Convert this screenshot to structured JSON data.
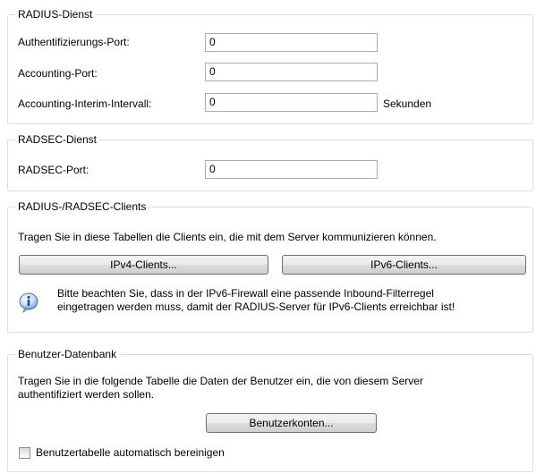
{
  "radius_service": {
    "legend": "RADIUS-Dienst",
    "auth_port_label": "Authentifizierungs-Port:",
    "auth_port_value": "0",
    "acct_port_label": "Accounting-Port:",
    "acct_port_value": "0",
    "interim_label": "Accounting-Interim-Intervall:",
    "interim_value": "0",
    "interim_unit": "Sekunden"
  },
  "radsec_service": {
    "legend": "RADSEC-Dienst",
    "port_label": "RADSEC-Port:",
    "port_value": "0"
  },
  "clients": {
    "legend": "RADIUS-/RADSEC-Clients",
    "description": "Tragen Sie in diese Tabellen die Clients ein, die mit dem Server kommunizieren können.",
    "ipv4_button": "IPv4-Clients...",
    "ipv6_button": "IPv6-Clients...",
    "info_icon": "info-icon",
    "info_line1": "Bitte beachten Sie, dass in der IPv6-Firewall eine passende Inbound-Filterregel",
    "info_line2": "eingetragen werden muss, damit der RADIUS-Server für IPv6-Clients erreichbar ist!"
  },
  "user_db": {
    "legend": "Benutzer-Datenbank",
    "description_line1": "Tragen Sie in die folgende Tabelle die Daten der Benutzer ein, die von diesem Server",
    "description_line2": "authentifiziert werden sollen.",
    "accounts_button": "Benutzerkonten...",
    "auto_cleanup_label": "Benutzertabelle automatisch bereinigen",
    "auto_cleanup_checked": false
  }
}
